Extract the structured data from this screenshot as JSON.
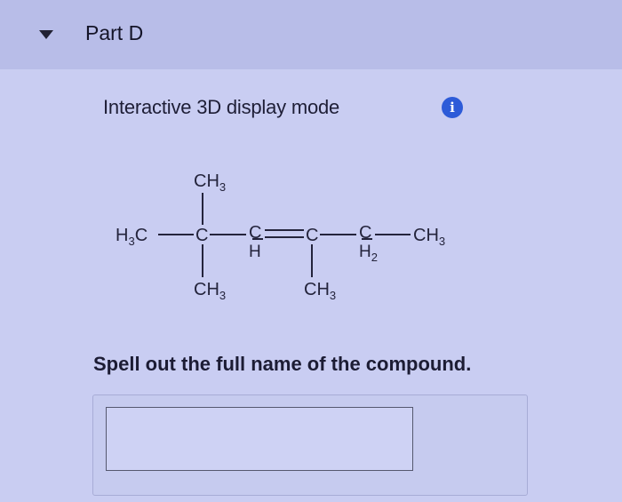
{
  "header": {
    "part_title": "Part D",
    "toggle_icon": "caret-down-icon"
  },
  "content": {
    "display_mode_label": "Interactive 3D display mode",
    "info_icon": "info-icon",
    "info_glyph": "i",
    "question": "Spell out the full name of the compound.",
    "answer_value": ""
  },
  "molecule": {
    "top_methyl": "CH",
    "top_methyl_sub": "3",
    "left_methyl": "H",
    "left_methyl_sub": "3",
    "left_methyl_c": "C",
    "carbon2": "C",
    "carbon3": "C",
    "h3": "H",
    "carbon4": "C",
    "carbon5": "C",
    "h5": "H",
    "h5_sub": "2",
    "right_methyl": "CH",
    "right_methyl_sub": "3",
    "bottom_methyl_1": "CH",
    "bottom_methyl_1_sub": "3",
    "bottom_methyl_2": "CH",
    "bottom_methyl_2_sub": "3"
  },
  "colors": {
    "page_bg": "#c9cdf2",
    "header_bg": "#b8bde8",
    "info_blue": "#2d5bd8"
  }
}
